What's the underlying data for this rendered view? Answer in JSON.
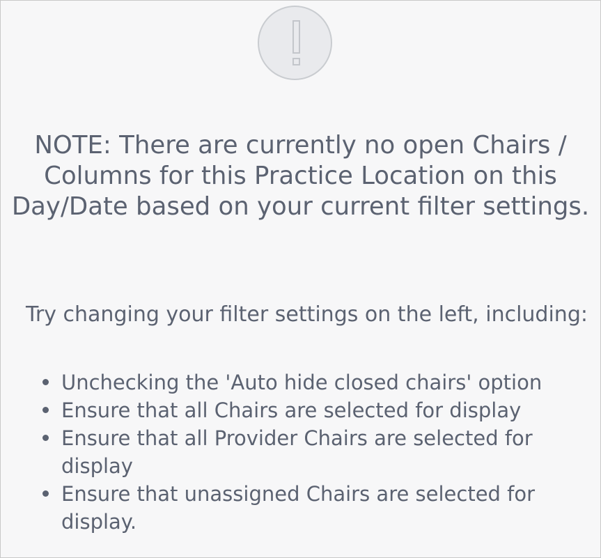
{
  "alert": {
    "icon": "exclamation-icon",
    "note": "NOTE: There are currently no open Chairs / Columns for this Practice Location on this Day/Date based on your current filter settings.",
    "instruction": "Try changing your filter settings on the left, including:",
    "tips": [
      "Unchecking the 'Auto hide closed chairs' option",
      "Ensure that all Chairs are selected for display",
      "Ensure that all Provider Chairs are selected for display",
      "Ensure that unassigned Chairs are selected for display."
    ]
  },
  "colors": {
    "text": "#5b6271",
    "panel_background": "#f7f7f8",
    "icon_fill": "#e9eaed",
    "icon_stroke": "#c9ccd0"
  }
}
